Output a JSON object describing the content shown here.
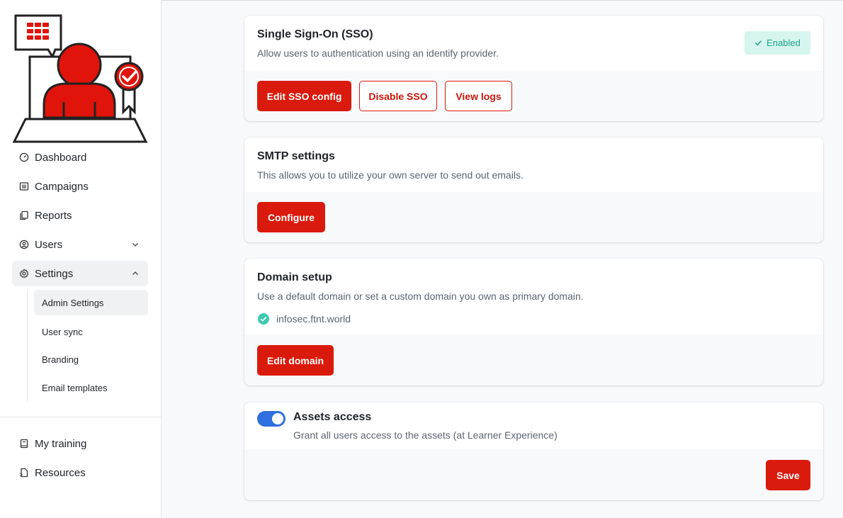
{
  "sidebar": {
    "nav": [
      {
        "label": "Dashboard",
        "icon": "dashboard-gauge-icon"
      },
      {
        "label": "Campaigns",
        "icon": "campaigns-icon"
      },
      {
        "label": "Reports",
        "icon": "reports-icon"
      },
      {
        "label": "Users",
        "icon": "users-icon"
      },
      {
        "label": "Settings",
        "icon": "settings-gear-icon"
      }
    ],
    "settings_sub": [
      {
        "label": "Admin Settings",
        "active": true
      },
      {
        "label": "User sync"
      },
      {
        "label": "Branding"
      },
      {
        "label": "Email templates"
      }
    ],
    "bottom": [
      {
        "label": "My training",
        "icon": "training-book-icon"
      },
      {
        "label": "Resources",
        "icon": "resources-icon"
      }
    ]
  },
  "sso": {
    "title": "Single Sign-On (SSO)",
    "description": "Allow users to authentication using an identify provider.",
    "status": "Enabled",
    "buttons": {
      "edit": "Edit SSO config",
      "disable": "Disable SSO",
      "logs": "View logs"
    }
  },
  "smtp": {
    "title": "SMTP settings",
    "description": "This allows you to utilize your own server to send out emails.",
    "button": "Configure"
  },
  "domain": {
    "title": "Domain setup",
    "description": "Use a default domain or set a custom domain you own as primary domain.",
    "current": "infosec.ftnt.world",
    "button": "Edit domain"
  },
  "assets": {
    "title": "Assets access",
    "description": "Grant all users access to the assets (at Learner Experience)",
    "enabled": true,
    "button": "Save"
  },
  "colors": {
    "brand_red": "#da1a0c",
    "success_green": "#1fa58a",
    "toggle_blue": "#2f6fe0"
  }
}
